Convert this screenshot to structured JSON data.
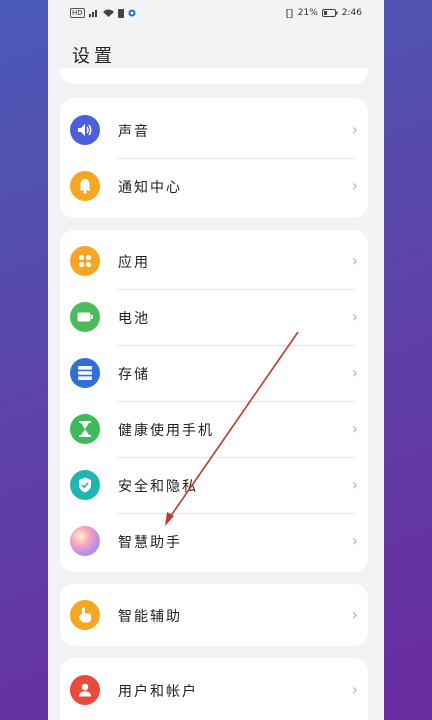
{
  "status_bar": {
    "left_badges": [
      "HD",
      "⁴⁶"
    ],
    "battery_percent": "21%",
    "time": "2:46"
  },
  "header": {
    "title": "设置"
  },
  "groups": [
    {
      "items": [
        {
          "label": "声音",
          "icon": "speaker-icon",
          "color": "#4b5fdc"
        },
        {
          "label": "通知中心",
          "icon": "bell-icon",
          "color": "#f5a623"
        }
      ]
    },
    {
      "items": [
        {
          "label": "应用",
          "icon": "apps-grid-icon",
          "color": "#f5a623"
        },
        {
          "label": "电池",
          "icon": "battery-icon",
          "color": "#4cbb5d"
        },
        {
          "label": "存储",
          "icon": "storage-icon",
          "color": "#2f6fd6"
        },
        {
          "label": "健康使用手机",
          "icon": "hourglass-icon",
          "color": "#3dbb5b"
        },
        {
          "label": "安全和隐私",
          "icon": "shield-icon",
          "color": "#1fb5b5"
        },
        {
          "label": "智慧助手",
          "icon": "assistant-orb-icon",
          "color": "#b48ef0"
        }
      ]
    },
    {
      "items": [
        {
          "label": "智能辅助",
          "icon": "hand-pointer-icon",
          "color": "#f5a623"
        }
      ]
    },
    {
      "items": [
        {
          "label": "用户和帐户",
          "icon": "user-icon",
          "color": "#e84a3d"
        }
      ]
    }
  ],
  "annotation": {
    "arrow_color": "#c0392b"
  }
}
